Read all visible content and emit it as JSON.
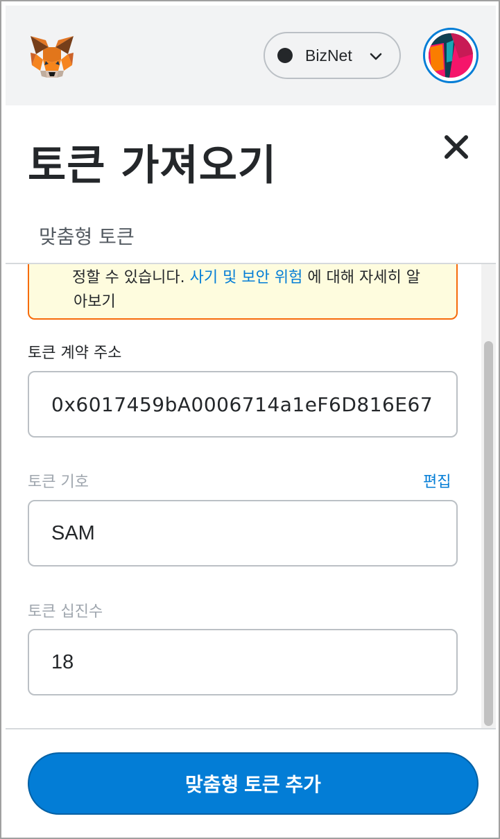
{
  "header": {
    "network": {
      "name": "BizNet",
      "dot_color": "#24272a"
    },
    "icons": {
      "logo": "metamask-fox-icon",
      "dropdown": "chevron-down-icon",
      "account": "account-avatar-icon"
    }
  },
  "page": {
    "title": "토큰 가져오기",
    "close_icon": "close-icon",
    "tabs": [
      {
        "label": "맞춤형 토큰",
        "selected": true
      }
    ]
  },
  "warning": {
    "line1_prefix": "정할 수 있습니다. ",
    "link_text": "사기 및 보안 위험",
    "line1_suffix": " 에 대해 자세히 알",
    "line2": "아보기"
  },
  "form": {
    "address": {
      "label": "토큰 계약 주소",
      "value": "0x6017459bA0006714a1eF6D816E67"
    },
    "symbol": {
      "label": "토큰 기호",
      "edit_label": "편집",
      "value": "SAM"
    },
    "decimals": {
      "label": "토큰 십진수",
      "value": "18"
    }
  },
  "footer": {
    "submit_label": "맞춤형 토큰 추가"
  },
  "colors": {
    "primary": "#037dd6",
    "warning_bg": "#fefcde",
    "warning_border": "#f66a0a",
    "text": "#24272a",
    "muted": "#9fa6ae"
  }
}
